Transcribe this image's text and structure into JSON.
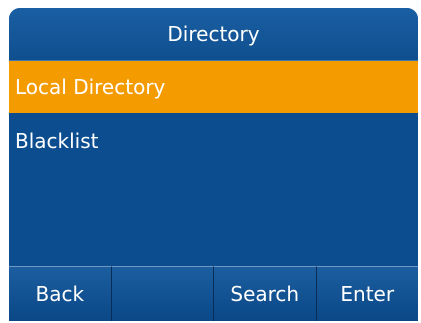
{
  "header": {
    "title": "Directory"
  },
  "list": {
    "items": [
      {
        "label": "Local Directory",
        "selected": true
      },
      {
        "label": "Blacklist",
        "selected": false
      }
    ]
  },
  "softkeys": [
    {
      "label": "Back"
    },
    {
      "label": ""
    },
    {
      "label": "Search"
    },
    {
      "label": "Enter"
    }
  ],
  "colors": {
    "screen_background": "#0b4d8f",
    "selection_highlight": "#f49b00",
    "text": "#ffffff"
  }
}
